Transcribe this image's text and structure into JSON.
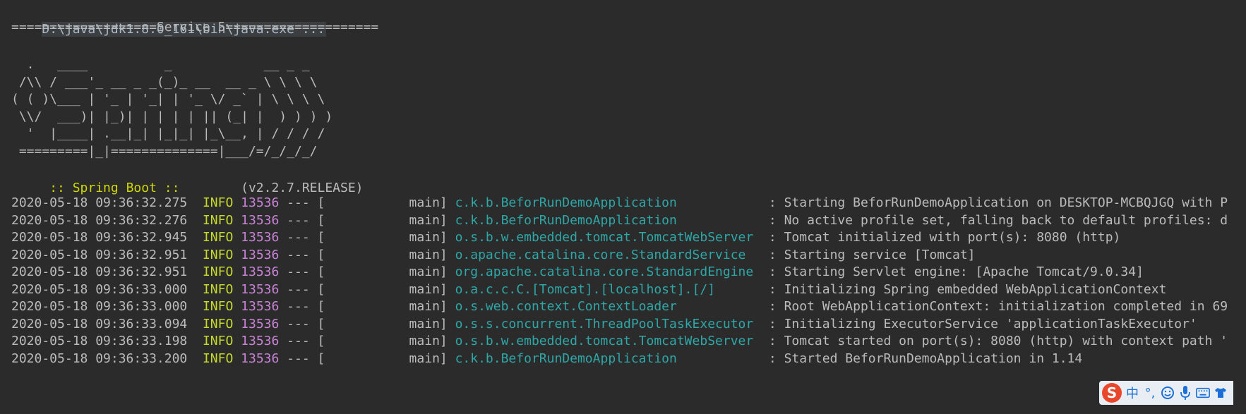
{
  "console": {
    "command": "D:\\java\\jdk1.8.0_161\\bin\\java.exe ...",
    "service_header": "===================Service 5====================",
    "banner": [
      "  .   ____          _            __ _ _",
      " /\\\\ / ___'_ __ _ _(_)_ __  __ _ \\ \\ \\ \\",
      "( ( )\\___ | '_ | '_| | '_ \\/ _` | \\ \\ \\ \\",
      " \\\\/  ___)| |_)| | | | | || (_| |  ) ) ) )",
      "  '  |____| .__|_| |_|_| |_\\__, | / / / /",
      " =========|_|==============|___/=/_/_/_/"
    ],
    "spring_label": " :: Spring Boot :: ",
    "spring_version": "       (v2.2.7.RELEASE)",
    "logs": [
      {
        "timestamp": "2020-05-18 09:36:32.275",
        "level": "INFO",
        "pid": "13536",
        "thread": " --- [           main] ",
        "logger": "c.k.b.BeforRunDemoApplication           ",
        "message": " : Starting BeforRunDemoApplication on DESKTOP-MCBQJGQ with P"
      },
      {
        "timestamp": "2020-05-18 09:36:32.276",
        "level": "INFO",
        "pid": "13536",
        "thread": " --- [           main] ",
        "logger": "c.k.b.BeforRunDemoApplication           ",
        "message": " : No active profile set, falling back to default profiles: d"
      },
      {
        "timestamp": "2020-05-18 09:36:32.945",
        "level": "INFO",
        "pid": "13536",
        "thread": " --- [           main] ",
        "logger": "o.s.b.w.embedded.tomcat.TomcatWebServer ",
        "message": " : Tomcat initialized with port(s): 8080 (http)"
      },
      {
        "timestamp": "2020-05-18 09:36:32.951",
        "level": "INFO",
        "pid": "13536",
        "thread": " --- [           main] ",
        "logger": "o.apache.catalina.core.StandardService  ",
        "message": " : Starting service [Tomcat]"
      },
      {
        "timestamp": "2020-05-18 09:36:32.951",
        "level": "INFO",
        "pid": "13536",
        "thread": " --- [           main] ",
        "logger": "org.apache.catalina.core.StandardEngine ",
        "message": " : Starting Servlet engine: [Apache Tomcat/9.0.34]"
      },
      {
        "timestamp": "2020-05-18 09:36:33.000",
        "level": "INFO",
        "pid": "13536",
        "thread": " --- [           main] ",
        "logger": "o.a.c.c.C.[Tomcat].[localhost].[/]      ",
        "message": " : Initializing Spring embedded WebApplicationContext"
      },
      {
        "timestamp": "2020-05-18 09:36:33.000",
        "level": "INFO",
        "pid": "13536",
        "thread": " --- [           main] ",
        "logger": "o.s.web.context.ContextLoader           ",
        "message": " : Root WebApplicationContext: initialization completed in 69"
      },
      {
        "timestamp": "2020-05-18 09:36:33.094",
        "level": "INFO",
        "pid": "13536",
        "thread": " --- [           main] ",
        "logger": "o.s.s.concurrent.ThreadPoolTaskExecutor ",
        "message": " : Initializing ExecutorService 'applicationTaskExecutor'"
      },
      {
        "timestamp": "2020-05-18 09:36:33.198",
        "level": "INFO",
        "pid": "13536",
        "thread": " --- [           main] ",
        "logger": "o.s.b.w.embedded.tomcat.TomcatWebServer ",
        "message": " : Tomcat started on port(s): 8080 (http) with context path '"
      },
      {
        "timestamp": "2020-05-18 09:36:33.200",
        "level": "INFO",
        "pid": "13536",
        "thread": " --- [           main] ",
        "logger": "c.k.b.BeforRunDemoApplication           ",
        "message": " : Started BeforRunDemoApplication in 1.14"
      }
    ]
  },
  "ime": {
    "logo": "S",
    "lang": "中",
    "punct": "°,",
    "icons": [
      "emoji-icon",
      "microphone-icon",
      "keyboard-icon",
      "shirt-icon"
    ]
  },
  "colors": {
    "background": "#2b2b2b",
    "text": "#bbbbbb",
    "info": "#c7d92a",
    "pid": "#c983d6",
    "logger": "#2fa7a7",
    "spring_label": "#cfd800"
  }
}
